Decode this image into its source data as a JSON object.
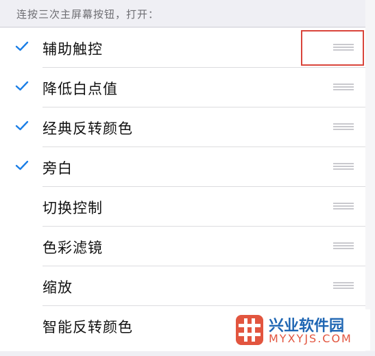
{
  "header": {
    "text": "连按三次主屏幕按钮，打开："
  },
  "list": {
    "items": [
      {
        "label": "辅助触控",
        "checked": true
      },
      {
        "label": "降低白点值",
        "checked": true
      },
      {
        "label": "经典反转颜色",
        "checked": true
      },
      {
        "label": "旁白",
        "checked": true
      },
      {
        "label": "切换控制",
        "checked": false
      },
      {
        "label": "色彩滤镜",
        "checked": false
      },
      {
        "label": "缩放",
        "checked": false
      },
      {
        "label": "智能反转颜色",
        "checked": false
      }
    ]
  },
  "watermark": {
    "title": "兴业软件园",
    "url": "MYXYJS.COM"
  },
  "colors": {
    "accent": "#1a7ee6",
    "highlight": "#d9443a",
    "watermark_blue": "#1f66b3",
    "watermark_orange": "#e2553f"
  },
  "icons": {
    "check": "checkmark-icon",
    "reorder": "reorder-grip-icon",
    "logo": "watermark-logo-icon"
  }
}
